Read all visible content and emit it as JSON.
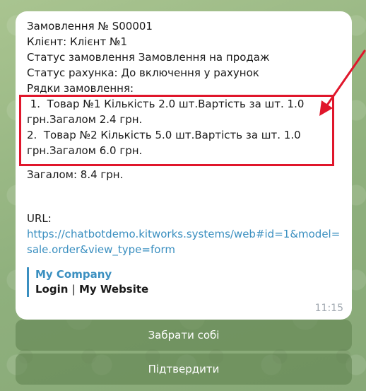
{
  "message": {
    "order_line": "Замовлення № S00001",
    "client_line": "Клієнт: Клієнт №1",
    "order_status_line": "Статус замовлення Замовлення на продаж",
    "invoice_status_line": "Статус рахунка: До включення у рахунок",
    "lines_header": "Рядки замовлення:",
    "line1_a": " 1.  Товар №1 Кількість 2.0 шт.Вартість за шт. 1.0",
    "line1_b": "грн.Загалом 2.4 грн.",
    "line2_a": "2.  Товар №2 Кількість 5.0 шт.Вартість за шт. 1.0",
    "line2_b": "грн.Загалом 6.0 грн.",
    "total_line": "Загалом: 8.4 грн.",
    "url_label": "URL:",
    "url_line1": "https://chatbotdemo.kitworks.systems/web#id=1&model=",
    "url_line2": "sale.order&view_type=form",
    "company": "My Company",
    "login_label": "Login",
    "separator": "|",
    "website_label": "My Website",
    "time": "11:15"
  },
  "keyboard": {
    "pickup_button": "Забрати собі",
    "confirm_button": "Підтвердити"
  },
  "colors": {
    "annotation": "#e0162b",
    "link": "#3a8fc0"
  }
}
